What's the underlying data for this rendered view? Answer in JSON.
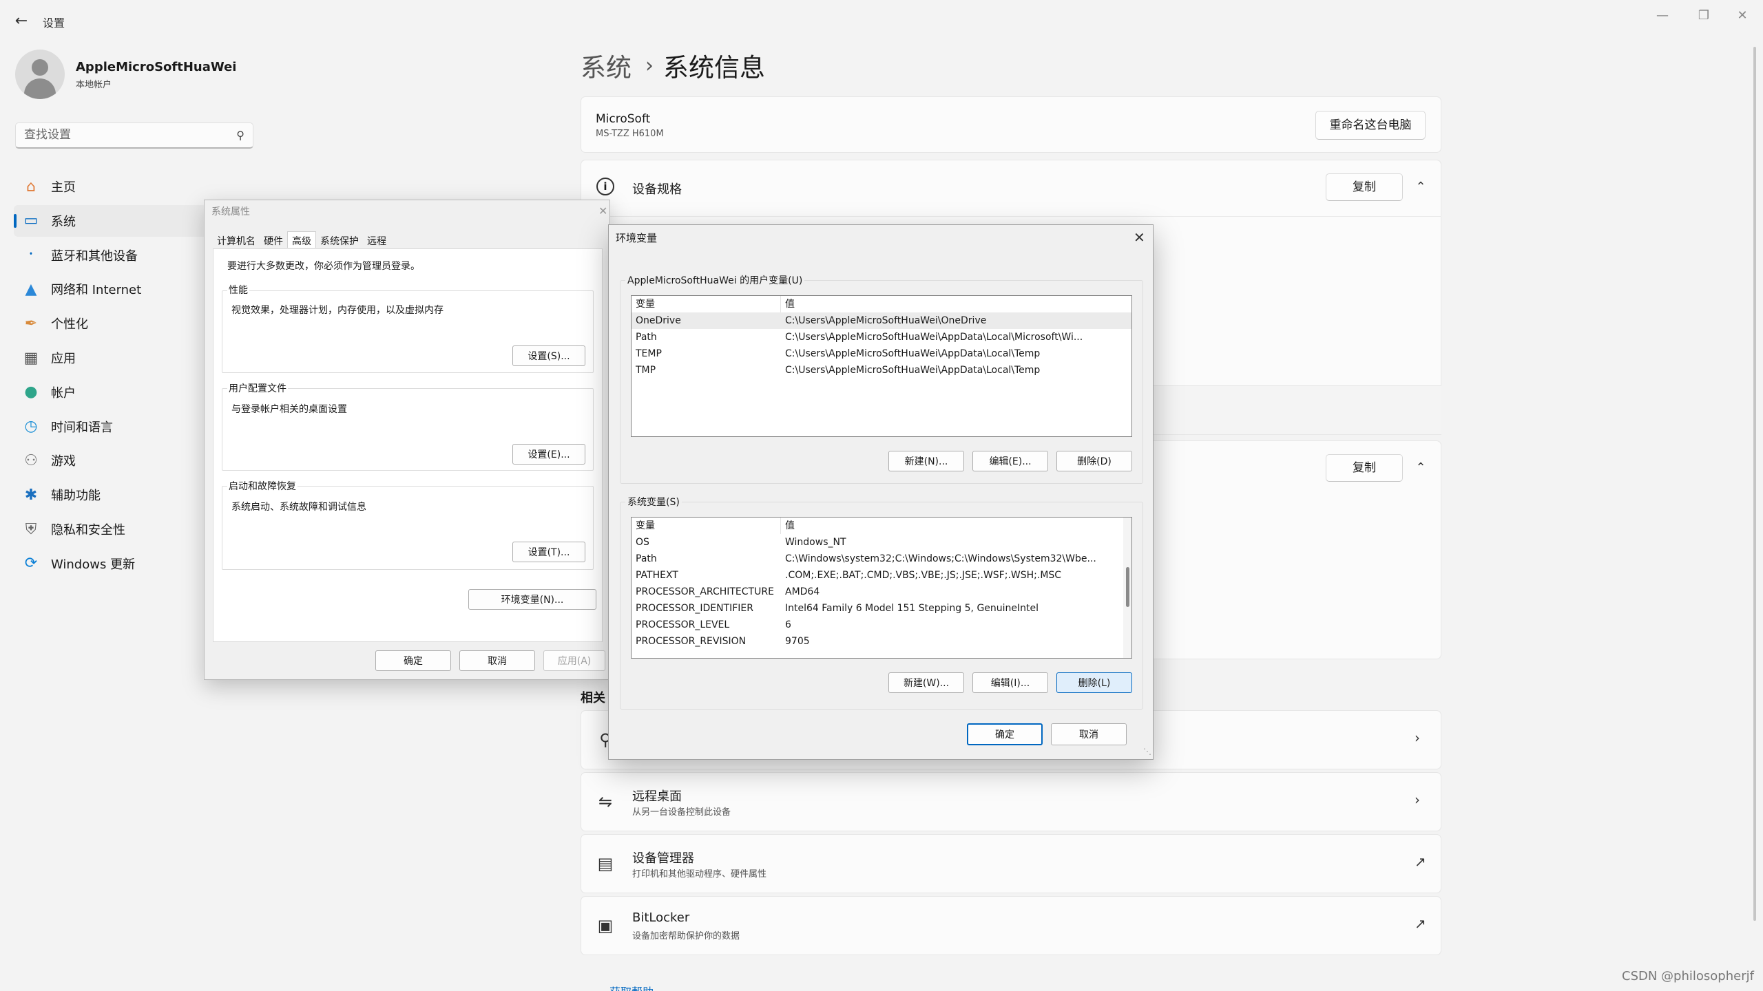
{
  "settings": {
    "app_title": "设置",
    "user": {
      "name": "AppleMicroSoftHuaWei",
      "type": "本地帐户"
    },
    "search_placeholder": "查找设置",
    "nav": [
      {
        "label": "主页",
        "icon": "home-icon"
      },
      {
        "label": "系统",
        "icon": "system-icon"
      },
      {
        "label": "蓝牙和其他设备",
        "icon": "bluetooth-icon"
      },
      {
        "label": "网络和 Internet",
        "icon": "wifi-icon"
      },
      {
        "label": "个性化",
        "icon": "brush-icon"
      },
      {
        "label": "应用",
        "icon": "apps-icon"
      },
      {
        "label": "帐户",
        "icon": "account-icon"
      },
      {
        "label": "时间和语言",
        "icon": "globe-clock-icon"
      },
      {
        "label": "游戏",
        "icon": "gamepad-icon"
      },
      {
        "label": "辅助功能",
        "icon": "accessibility-icon"
      },
      {
        "label": "隐私和安全性",
        "icon": "shield-icon"
      },
      {
        "label": "Windows 更新",
        "icon": "update-icon"
      }
    ],
    "active_nav": "系统",
    "breadcrumb": {
      "parent": "系统",
      "current": "系统信息"
    },
    "pc": {
      "name": "MicroSoft",
      "model": "MS-TZZ H610M",
      "rename_label": "重命名这台电脑"
    },
    "spec": {
      "title": "设备规格",
      "copy_label": "复制"
    },
    "spec2": {
      "copy_label": "复制"
    },
    "related": {
      "title": "相关",
      "items": [
        {
          "title": "",
          "sub": "",
          "icon": "key-icon",
          "action": "chevron-right-icon"
        },
        {
          "title": "远程桌面",
          "sub": "从另一台设备控制此设备",
          "icon": "remote-desktop-icon",
          "action": "chevron-right-icon"
        },
        {
          "title": "设备管理器",
          "sub": "打印机和其他驱动程序、硬件属性",
          "icon": "device-manager-icon",
          "action": "external-link-icon"
        },
        {
          "title": "BitLocker",
          "sub": "设备加密帮助保护你的数据",
          "icon": "bitlocker-icon",
          "action": "external-link-icon"
        }
      ]
    },
    "get_help": "获取帮助"
  },
  "system_properties": {
    "title": "系统属性",
    "tabs": [
      "计算机名",
      "硬件",
      "高级",
      "系统保护",
      "远程"
    ],
    "active_tab": "高级",
    "note": "要进行大多数更改，你必须作为管理员登录。",
    "groups": [
      {
        "label": "性能",
        "desc": "视觉效果，处理器计划，内存使用，以及虚拟内存",
        "button": "设置(S)..."
      },
      {
        "label": "用户配置文件",
        "desc": "与登录帐户相关的桌面设置",
        "button": "设置(E)..."
      },
      {
        "label": "启动和故障恢复",
        "desc": "系统启动、系统故障和调试信息",
        "button": "设置(T)..."
      }
    ],
    "env_button": "环境变量(N)...",
    "ok": "确定",
    "cancel": "取消",
    "apply": "应用(A)"
  },
  "env_vars": {
    "title": "环境变量",
    "user_group_label": "AppleMicroSoftHuaWei 的用户变量(U)",
    "columns": [
      "变量",
      "值"
    ],
    "user_vars": [
      [
        "OneDrive",
        "C:\\Users\\AppleMicroSoftHuaWei\\OneDrive"
      ],
      [
        "Path",
        "C:\\Users\\AppleMicroSoftHuaWei\\AppData\\Local\\Microsoft\\Wi..."
      ],
      [
        "TEMP",
        "C:\\Users\\AppleMicroSoftHuaWei\\AppData\\Local\\Temp"
      ],
      [
        "TMP",
        "C:\\Users\\AppleMicroSoftHuaWei\\AppData\\Local\\Temp"
      ]
    ],
    "user_buttons": [
      "新建(N)...",
      "编辑(E)...",
      "删除(D)"
    ],
    "system_group_label": "系统变量(S)",
    "system_vars": [
      [
        "OS",
        "Windows_NT"
      ],
      [
        "Path",
        "C:\\Windows\\system32;C:\\Windows;C:\\Windows\\System32\\Wbe..."
      ],
      [
        "PATHEXT",
        ".COM;.EXE;.BAT;.CMD;.VBS;.VBE;.JS;.JSE;.WSF;.WSH;.MSC"
      ],
      [
        "PROCESSOR_ARCHITECTURE",
        "AMD64"
      ],
      [
        "PROCESSOR_IDENTIFIER",
        "Intel64 Family 6 Model 151 Stepping 5, GenuineIntel"
      ],
      [
        "PROCESSOR_LEVEL",
        "6"
      ],
      [
        "PROCESSOR_REVISION",
        "9705"
      ]
    ],
    "system_buttons": [
      "新建(W)...",
      "编辑(I)...",
      "删除(L)"
    ],
    "ok": "确定",
    "cancel": "取消"
  },
  "watermark": "CSDN @philosopherjf"
}
